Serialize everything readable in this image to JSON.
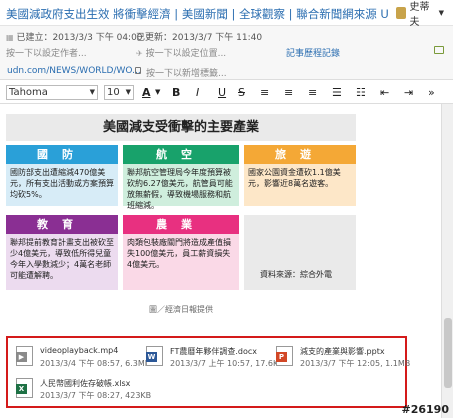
{
  "titlebar": {
    "title": "美國減政府支出生效 將衝擊經濟 | 美國新聞 | 全球觀察 | 聯合新聞網來源 URL：http",
    "user_label": "史蒂夫"
  },
  "meta": {
    "created_label": "已建立：",
    "created_value": "2013/3/3 下午 04:00",
    "updated_label": "已更新：",
    "updated_value": "2013/3/7 下午 11:40",
    "sub_left": "按一下以設定作者...",
    "sub_mid": "按一下以設定位置...",
    "sub_right": "按一下以設定標籤...",
    "record_link": "記事歷程記錄"
  },
  "url_row": {
    "url": "udn.com/NEWS/WORLD/WO...",
    "tag_placeholder": "按一下以新增標籤..."
  },
  "toolbar": {
    "font": "Tahoma",
    "size": "10",
    "buttons": {
      "color": "A",
      "bold": "B",
      "italic": "I",
      "underline": "U",
      "strike": "S"
    }
  },
  "infographic": {
    "title": "美國減支受衝擊的主要產業",
    "boxes": [
      {
        "head": "國防",
        "body": "國防部支出遭縮減470億美元，所有支出活動或方案預算均砍5%。",
        "color": "#2aa0d8"
      },
      {
        "head": "航空",
        "body": "聯邦航空管理局今年度預算被砍約6.27億美元，航管員可能放無薪假，導致機場服務和航班縮減。",
        "color": "#18a26b"
      },
      {
        "head": "旅遊",
        "body": "國家公園資金遭砍1.1億美元，影響近8萬名遊客。",
        "color": "#f4a836"
      },
      {
        "head": "教育",
        "body": "聯邦提前教育計畫支出被砍至少4億美元，導致低所得兒童今年入學數減少；4萬名老師可能遭解聘。",
        "color": "#8a2f93"
      },
      {
        "head": "農業",
        "body": "肉類包裝廠關門將造成產值損失100億美元，員工薪資損失4億美元。",
        "color": "#e83080"
      }
    ],
    "source": "資料來源：綜合外電",
    "caption": "圖／經濟日報提供"
  },
  "attachments": [
    {
      "name": "videoplayback.mp4",
      "info": "2013/3/4 下午 08:57, 6.3MB",
      "icon": "video-file-icon",
      "color": "#8a8a8a"
    },
    {
      "name": "FT農曆年夥伴調查.docx",
      "info": "2013/3/7 上午 10:57, 17.6KB",
      "icon": "word-file-icon",
      "color": "#2b5797"
    },
    {
      "name": "減支的產業與影響.pptx",
      "info": "2013/3/7 下午 12:05, 1.1MB",
      "icon": "powerpoint-file-icon",
      "color": "#d24726"
    },
    {
      "name": "人民幣國利佐存破帳.xlsx",
      "info": "2013/3/7 下午 08:27, 423KB",
      "icon": "excel-file-icon",
      "color": "#1e7145"
    }
  ],
  "watermark": "#26190"
}
